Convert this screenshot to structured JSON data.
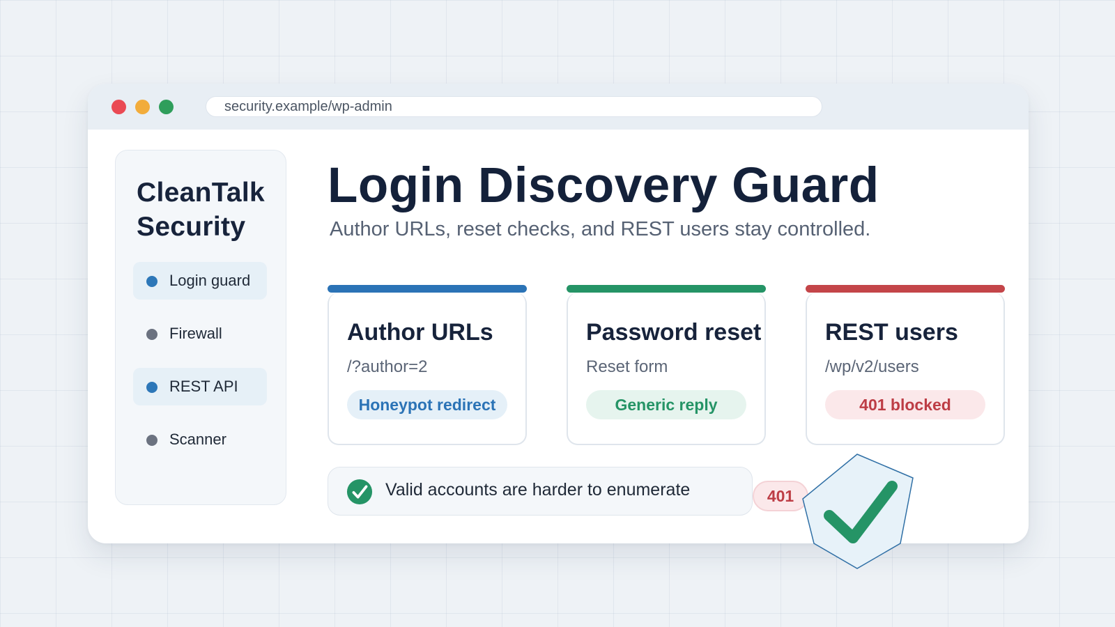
{
  "window": {
    "url": "security.example/wp-admin",
    "controls": {
      "close_color": "#ea4a54",
      "minimize_color": "#f2ac3b",
      "maximize_color": "#2f9e5b"
    }
  },
  "sidebar": {
    "brand_line1": "CleanTalk",
    "brand_line2": "Security",
    "items": [
      {
        "label": "Login guard",
        "active": true,
        "dot_color": "#2d77b8"
      },
      {
        "label": "Firewall",
        "active": false,
        "dot_color": "#6b7280"
      },
      {
        "label": "REST API",
        "active": true,
        "dot_color": "#2d77b8"
      },
      {
        "label": "Scanner",
        "active": false,
        "dot_color": "#6b7280"
      }
    ]
  },
  "main": {
    "title": "Login Discovery Guard",
    "subtitle": "Author URLs, reset checks, and REST users stay controlled."
  },
  "cards": [
    {
      "title": "Author URLs",
      "subtitle": "/?author=2",
      "pill": "Honeypot redirect",
      "accent_color": "#2b73b6",
      "pill_bg": "#e5f0f8",
      "pill_color": "#2b73b6"
    },
    {
      "title": "Password reset",
      "subtitle": "Reset form",
      "pill": "Generic reply",
      "accent_color": "#259466",
      "pill_bg": "#e6f4ee",
      "pill_color": "#259466"
    },
    {
      "title": "REST users",
      "subtitle": "/wp/v2/users",
      "pill": "401 blocked",
      "accent_color": "#c44549",
      "pill_bg": "#fbe8ea",
      "pill_color": "#bd3d45"
    }
  ],
  "status": {
    "text": "Valid accounts are harder to enumerate",
    "icon": "check-circle-icon",
    "icon_color": "#259466"
  },
  "floating_badge": {
    "text": "401"
  },
  "shield": {
    "icon": "shield-check-icon",
    "fill": "#e7f2f9",
    "stroke": "#2f6fa5",
    "check_color": "#259466"
  }
}
